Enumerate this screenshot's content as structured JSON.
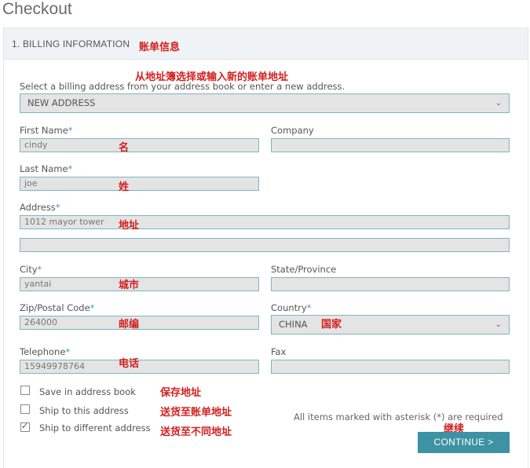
{
  "page": {
    "title": "Checkout"
  },
  "section": {
    "title": "1. BILLING INFORMATION",
    "annotation": "账单信息"
  },
  "address_select": {
    "prompt": "Select a billing address from your address book or enter a new address.",
    "prompt_annotation": "从地址簿选择或输入新的账单地址",
    "value": "NEW ADDRESS"
  },
  "fields": {
    "first_name": {
      "label": "First Name",
      "value": "cindy",
      "annotation": "名"
    },
    "company": {
      "label": "Company",
      "value": ""
    },
    "last_name": {
      "label": "Last Name",
      "value": "joe",
      "annotation": "姓"
    },
    "address": {
      "label": "Address",
      "value": "1012 mayor tower",
      "line2": "",
      "annotation": "地址"
    },
    "city": {
      "label": "City",
      "value": "yantai",
      "annotation": "城市"
    },
    "state": {
      "label": "State/Province",
      "value": ""
    },
    "zip": {
      "label": "Zip/Postal Code",
      "value": "264000",
      "annotation": "邮编"
    },
    "country": {
      "label": "Country",
      "value": "CHINA",
      "annotation": "国家"
    },
    "telephone": {
      "label": "Telephone",
      "value": "15949978764",
      "annotation": "电话"
    },
    "fax": {
      "label": "Fax",
      "value": ""
    }
  },
  "required_mark": "*",
  "options": [
    {
      "label": "Save in address book",
      "checked": false,
      "annotation": "保存地址"
    },
    {
      "label": "Ship to this address",
      "checked": false,
      "annotation": "送货至账单地址"
    },
    {
      "label": "Ship to different address",
      "checked": true,
      "annotation": "送货至不同地址"
    }
  ],
  "required_note": "All items marked with asterisk (*) are required",
  "continue": {
    "label": "CONTINUE >",
    "annotation": "继续"
  },
  "colors": {
    "accent": "#3d92a3",
    "annotation": "#d32020",
    "field_bg": "#e4e4e4",
    "field_border": "#7fb6c2"
  }
}
